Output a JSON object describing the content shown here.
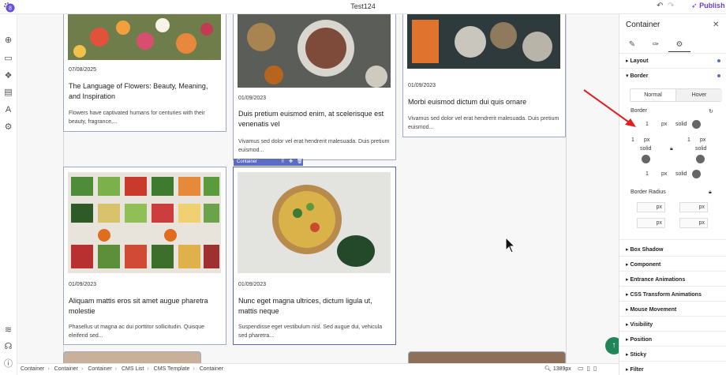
{
  "app": {
    "title": "Test124",
    "publish_label": "Publish",
    "undo_icon": "undo-icon",
    "redo_icon": "redo-icon"
  },
  "left_toolbar": {
    "icons": [
      "add-icon",
      "section-icon",
      "components-icon",
      "pages-icon",
      "typography-icon",
      "settings-icon",
      "layers-icon",
      "integrations-icon",
      "info-icon"
    ]
  },
  "cards": [
    {
      "date": "07/08/2025",
      "title": "The Language of Flowers: Beauty, Meaning, and Inspiration",
      "excerpt": "Flowers have captivated humans for centuries with their beauty, fragrance,..."
    },
    {
      "date": "01/09/2023",
      "title": "Duis pretium euismod enim, at scelerisque est venenatis vel",
      "excerpt": "Vivamus sed dolor vel erat hendrerit malesuada. Duis pretium euismod..."
    },
    {
      "date": "01/09/2023",
      "title": "Morbi euismod dictum dui quis ornare",
      "excerpt": "Vivamus sed dolor vel erat hendrerit malesuada. Duis pretium euismod..."
    },
    {
      "date": "01/09/2023",
      "title": "Aliquam mattis eros sit amet augue pharetra molestie",
      "excerpt": "Phasellus ut magna ac dui porttitor sollicitudin. Quisque eleifend sed..."
    },
    {
      "date": "01/09/2023",
      "title": "Nunc eget magna ultrices, dictum ligula ut, mattis neque",
      "excerpt": "Suspendisse eget vestibulum nisl. Sed augue dui, vehicula sed pharetra..."
    }
  ],
  "selection_tag": {
    "label": "Container"
  },
  "breadcrumb": [
    "Container",
    "Container",
    "Container",
    "CMS List",
    "CMS Template",
    "Container"
  ],
  "zoom": "1389px",
  "panel": {
    "title": "Container",
    "tabs": [
      "brush-icon",
      "eyedropper-icon",
      "gear-icon"
    ],
    "sections_top": [
      {
        "label": "Layout"
      },
      {
        "label": "Border"
      }
    ],
    "border": {
      "states": [
        "Normal",
        "Hover"
      ],
      "label": "Border",
      "top": {
        "value": "1",
        "unit": "px",
        "style": "solid"
      },
      "left": {
        "value": "1",
        "unit": "px",
        "style": "solid"
      },
      "right": {
        "value": "1",
        "unit": "px",
        "style": "solid"
      },
      "bottom": {
        "value": "1",
        "unit": "px",
        "style": "solid"
      },
      "radius_label": "Border Radius",
      "radius_unit": "px",
      "color": "#666666"
    },
    "sections_bottom": [
      {
        "label": "Box Shadow"
      },
      {
        "label": "Component"
      },
      {
        "label": "Entrance Animations"
      },
      {
        "label": "CSS Transform Animations"
      },
      {
        "label": "Mouse Movement"
      },
      {
        "label": "Visibility"
      },
      {
        "label": "Position"
      },
      {
        "label": "Sticky"
      },
      {
        "label": "Filter"
      }
    ]
  },
  "colors": {
    "accent": "#5b6cc7",
    "publish": "#6b3fd6",
    "fab": "#22855a",
    "annotation": "#e02020"
  }
}
